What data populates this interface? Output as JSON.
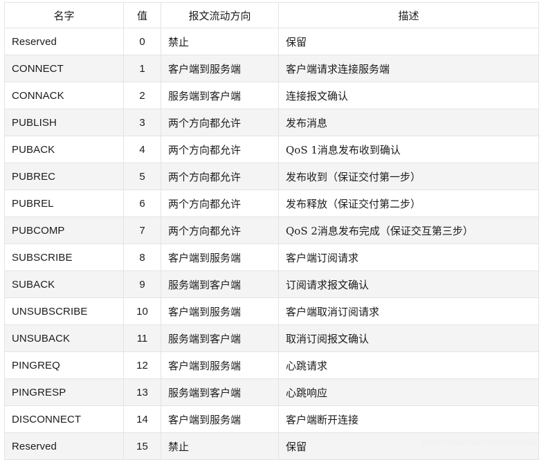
{
  "table": {
    "columns": [
      {
        "key": "name",
        "label": "名字",
        "align": "left"
      },
      {
        "key": "value",
        "label": "值",
        "align": "center"
      },
      {
        "key": "direction",
        "label": "报文流动方向",
        "align": "left"
      },
      {
        "key": "description",
        "label": "描述",
        "align": "left"
      }
    ],
    "rows": [
      {
        "name": "Reserved",
        "value": "0",
        "direction": "禁止",
        "description": "保留"
      },
      {
        "name": "CONNECT",
        "value": "1",
        "direction": "客户端到服务端",
        "description": "客户端请求连接服务端"
      },
      {
        "name": "CONNACK",
        "value": "2",
        "direction": "服务端到客户端",
        "description": "连接报文确认"
      },
      {
        "name": "PUBLISH",
        "value": "3",
        "direction": "两个方向都允许",
        "description": "发布消息"
      },
      {
        "name": "PUBACK",
        "value": "4",
        "direction": "两个方向都允许",
        "description": "QoS 1消息发布收到确认"
      },
      {
        "name": "PUBREC",
        "value": "5",
        "direction": "两个方向都允许",
        "description": "发布收到（保证交付第一步）"
      },
      {
        "name": "PUBREL",
        "value": "6",
        "direction": "两个方向都允许",
        "description": "发布释放（保证交付第二步）"
      },
      {
        "name": "PUBCOMP",
        "value": "7",
        "direction": "两个方向都允许",
        "description": "QoS 2消息发布完成（保证交互第三步）"
      },
      {
        "name": "SUBSCRIBE",
        "value": "8",
        "direction": "客户端到服务端",
        "description": "客户端订阅请求"
      },
      {
        "name": "SUBACK",
        "value": "9",
        "direction": "服务端到客户端",
        "description": "订阅请求报文确认"
      },
      {
        "name": "UNSUBSCRIBE",
        "value": "10",
        "direction": "客户端到服务端",
        "description": "客户端取消订阅请求"
      },
      {
        "name": "UNSUBACK",
        "value": "11",
        "direction": "服务端到客户端",
        "description": "取消订阅报文确认"
      },
      {
        "name": "PINGREQ",
        "value": "12",
        "direction": "客户端到服务端",
        "description": "心跳请求"
      },
      {
        "name": "PINGRESP",
        "value": "13",
        "direction": "服务端到客户端",
        "description": "心跳响应"
      },
      {
        "name": "DISCONNECT",
        "value": "14",
        "direction": "客户端到服务端",
        "description": "客户端断开连接"
      },
      {
        "name": "Reserved",
        "value": "15",
        "direction": "禁止",
        "description": "保留"
      }
    ]
  },
  "watermark": {
    "text": "https://blog.csdn.net/ntak0n82"
  },
  "colors": {
    "border": "#e3e3e3",
    "outer_border": "#dcdcdc",
    "row_odd_bg": "#ffffff",
    "row_even_bg": "#f4f4f4",
    "text": "#1b1b1b",
    "watermark": "#efefef",
    "page_bg": "#ffffff"
  }
}
